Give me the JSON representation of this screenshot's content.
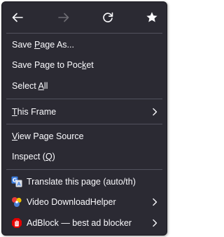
{
  "menu": {
    "nav": {
      "back_icon": "arrow-left-icon",
      "forward_icon": "arrow-right-icon",
      "reload_icon": "reload-icon",
      "bookmark_icon": "star-icon"
    },
    "items": [
      {
        "pre": "Save ",
        "key": "P",
        "post": "age As..."
      },
      {
        "pre": "Save Page to Poc",
        "key": "k",
        "post": "et"
      },
      {
        "pre": "Select ",
        "key": "A",
        "post": "ll"
      },
      {
        "pre": "",
        "key": "T",
        "post": "his Frame"
      },
      {
        "pre": "",
        "key": "V",
        "post": "iew Page Source"
      },
      {
        "pre": "Inspect (",
        "key": "Q",
        "post": ")"
      }
    ],
    "extensions": [
      {
        "label": "Translate this page (auto/th)",
        "icon": "translate-icon"
      },
      {
        "label": "Video DownloadHelper",
        "icon": "video-downloadhelper-icon"
      },
      {
        "label": "AdBlock — best ad blocker",
        "icon": "adblock-hand-icon"
      }
    ]
  },
  "colors": {
    "menu_bg": "#2b2a33",
    "text": "#fbfbfe",
    "disabled": "#6e6d74",
    "separator": "#52525e",
    "adblock_red": "#e40000"
  }
}
